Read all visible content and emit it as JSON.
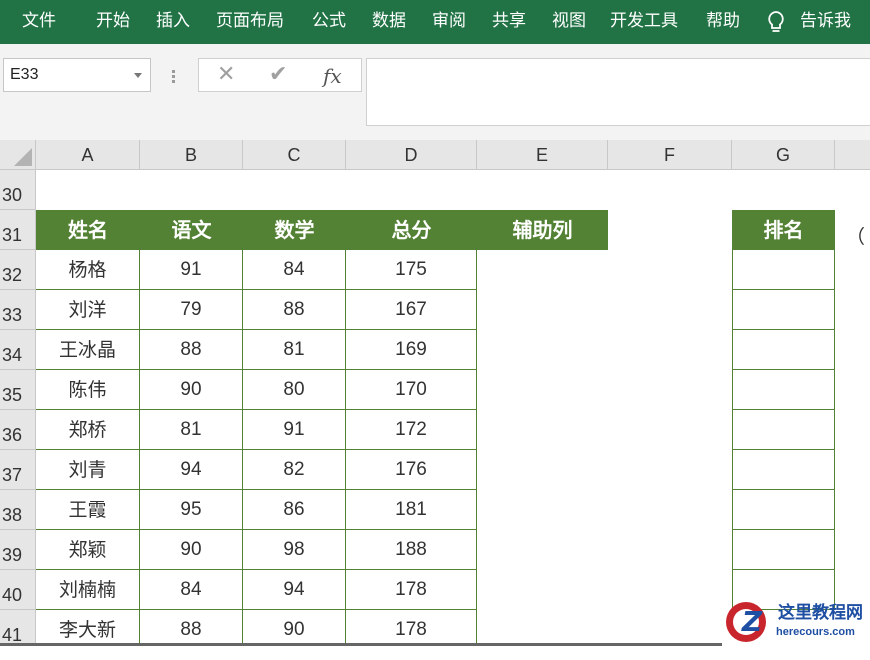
{
  "ribbon": {
    "tabs": [
      "文件",
      "开始",
      "插入",
      "页面布局",
      "公式",
      "数据",
      "审阅",
      "共享",
      "视图",
      "开发工具",
      "帮助",
      "告诉我"
    ],
    "background": "#217346"
  },
  "formula_bar": {
    "name_box": "E33",
    "cancel_icon": "✕",
    "enter_icon": "✔",
    "fx_label": "fx",
    "formula": ""
  },
  "columns": [
    "A",
    "B",
    "C",
    "D",
    "E",
    "F",
    "G"
  ],
  "rows": [
    "30",
    "31",
    "32",
    "33",
    "34",
    "35",
    "36",
    "37",
    "38",
    "39",
    "40",
    "41"
  ],
  "table": {
    "headers": [
      "姓名",
      "语文",
      "数学",
      "总分",
      "辅助列"
    ],
    "rank_header": "排名",
    "rows": [
      [
        "杨格",
        "91",
        "84",
        "175"
      ],
      [
        "刘洋",
        "79",
        "88",
        "167"
      ],
      [
        "王冰晶",
        "88",
        "81",
        "169"
      ],
      [
        "陈伟",
        "90",
        "80",
        "170"
      ],
      [
        "郑桥",
        "81",
        "91",
        "172"
      ],
      [
        "刘青",
        "94",
        "82",
        "176"
      ],
      [
        "王霞",
        "95",
        "86",
        "181"
      ],
      [
        "郑颖",
        "90",
        "98",
        "188"
      ],
      [
        "刘楠楠",
        "84",
        "94",
        "178"
      ],
      [
        "李大新",
        "88",
        "90",
        "178"
      ]
    ],
    "header_color": "#548235"
  },
  "overflow_text": "（",
  "watermark": {
    "logo_letter": "Z",
    "title": "这里教程网",
    "url": "herecours.com"
  }
}
